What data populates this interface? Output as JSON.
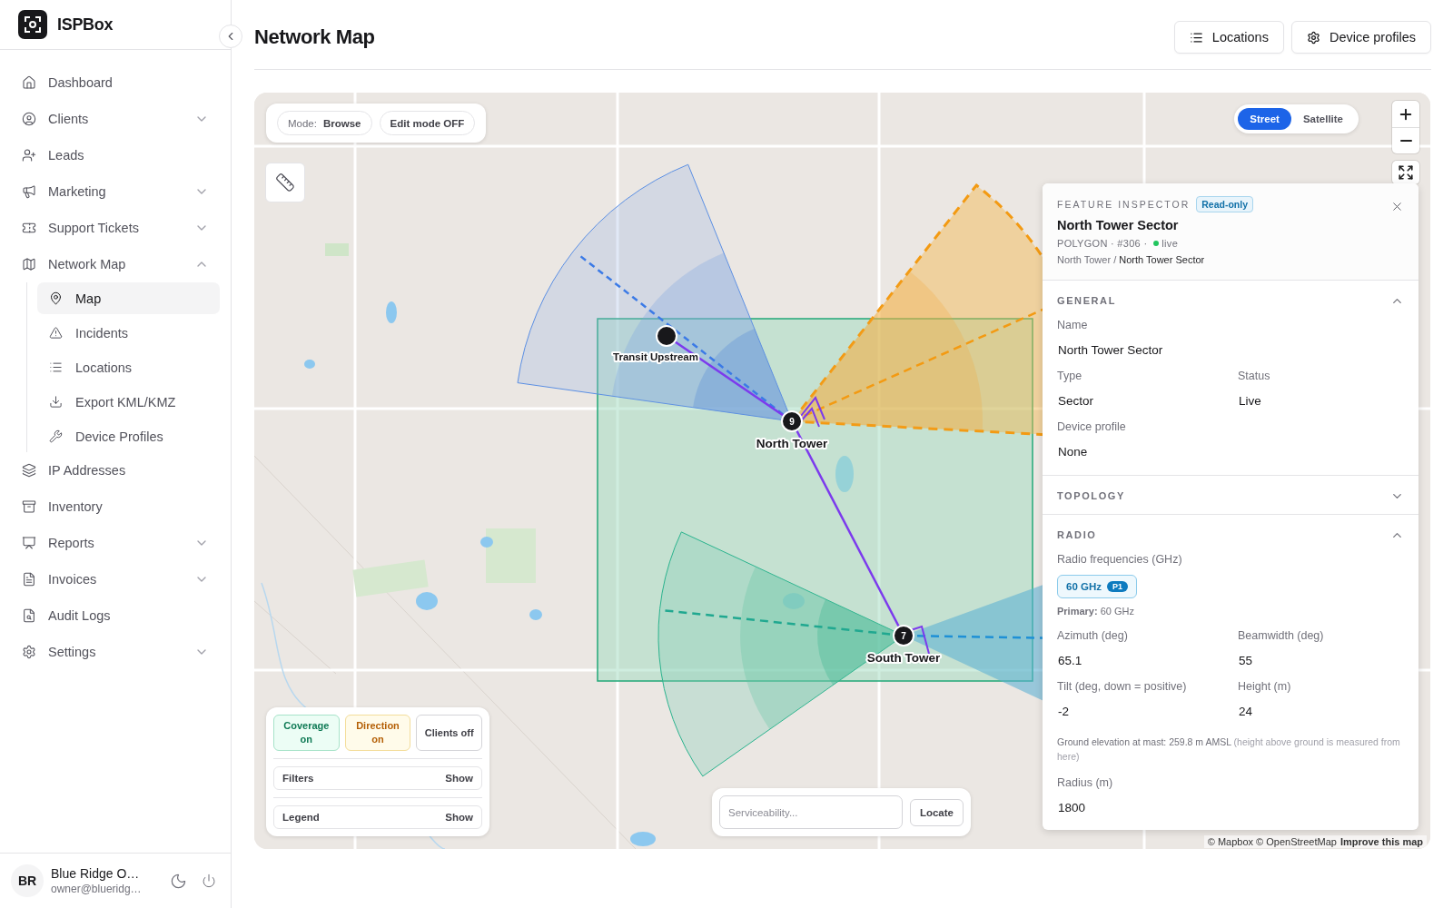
{
  "app": {
    "name": "ISPBox"
  },
  "sidebar": {
    "items": [
      {
        "label": "Dashboard",
        "kind": "link",
        "selected": false
      },
      {
        "label": "Clients",
        "kind": "group",
        "expanded": false,
        "selected": false
      },
      {
        "label": "Leads",
        "kind": "link",
        "selected": false
      },
      {
        "label": "Marketing",
        "kind": "group",
        "expanded": false,
        "selected": false
      },
      {
        "label": "Support Tickets",
        "kind": "group",
        "expanded": false,
        "selected": false
      },
      {
        "label": "Network Map",
        "kind": "group",
        "expanded": true,
        "selected": false,
        "children": [
          {
            "label": "Map",
            "selected": true
          },
          {
            "label": "Incidents",
            "selected": false
          },
          {
            "label": "Locations",
            "selected": false
          },
          {
            "label": "Export KML/KMZ",
            "selected": false
          },
          {
            "label": "Device Profiles",
            "selected": false
          }
        ]
      },
      {
        "label": "IP Addresses",
        "kind": "link",
        "selected": false
      },
      {
        "label": "Inventory",
        "kind": "link",
        "selected": false
      },
      {
        "label": "Reports",
        "kind": "group",
        "expanded": false,
        "selected": false
      },
      {
        "label": "Invoices",
        "kind": "group",
        "expanded": false,
        "selected": false
      },
      {
        "label": "Audit Logs",
        "kind": "link",
        "selected": false
      },
      {
        "label": "Settings",
        "kind": "group",
        "expanded": false,
        "selected": false
      }
    ]
  },
  "user": {
    "initials": "BR",
    "name": "Blue Ridge O…",
    "email": "owner@blueridg…"
  },
  "header": {
    "title": "Network Map",
    "buttons": [
      "Locations",
      "Device profiles"
    ]
  },
  "map": {
    "mode_label": "Mode:",
    "mode_value": "Browse",
    "edit_button": "Edit mode OFF",
    "basemaps": [
      {
        "label": "Street",
        "selected": true
      },
      {
        "label": "Satellite",
        "selected": false
      }
    ],
    "nodes": [
      {
        "label": "Transit Upstream"
      },
      {
        "label": "North Tower",
        "count": "9"
      },
      {
        "label": "South Tower",
        "count": "7"
      }
    ],
    "layer_toggles": [
      {
        "label": "Coverage on",
        "kind": "coverage",
        "on": true
      },
      {
        "label": "Direction on",
        "kind": "direction",
        "on": true
      },
      {
        "label": "Clients off",
        "kind": "clients",
        "on": false
      }
    ],
    "panels": [
      {
        "label": "Filters",
        "action": "Show"
      },
      {
        "label": "Legend",
        "action": "Show"
      }
    ],
    "search": {
      "placeholder": "Serviceability...",
      "button": "Locate"
    },
    "attribution": "© Mapbox © OpenStreetMap",
    "attribution_link": "Improve this map"
  },
  "inspector": {
    "heading": "FEATURE INSPECTOR",
    "badge": "Read-only",
    "title": "North Tower Sector",
    "meta": "POLYGON · #306 ·",
    "status": {
      "label": "live",
      "color": "#22c55e"
    },
    "breadcrumb": "North Tower / **North Tower Sector**",
    "sections": [
      {
        "title": "GENERAL",
        "expanded": true,
        "rows": [
          [
            {
              "label": "Name",
              "value": "North Tower Sector"
            }
          ],
          [
            {
              "label": "Type",
              "value": "Sector"
            },
            {
              "label": "Status",
              "value": "Live"
            }
          ],
          [
            {
              "label": "Device profile",
              "value": "None"
            }
          ]
        ]
      },
      {
        "title": "TOPOLOGY",
        "expanded": false
      },
      {
        "title": "RADIO",
        "expanded": true,
        "frequencies_label": "Radio frequencies (GHz)",
        "chips": [
          {
            "label": "60 GHz",
            "badge": "P1"
          }
        ],
        "primary": "**Primary:** 60 GHz",
        "rows": [
          [
            {
              "label": "Azimuth (deg)",
              "value": "65.1"
            },
            {
              "label": "Beamwidth (deg)",
              "value": "55"
            }
          ],
          [
            {
              "label": "Tilt (deg, down = positive)",
              "value": "-2"
            },
            {
              "label": "Height (m)",
              "value": "24"
            }
          ]
        ],
        "note": "Ground elevation at mast: 259.8 m AMSL",
        "note_aside": "(height above ground is measured from here)",
        "after_rows": [
          [
            {
              "label": "Radius (m)",
              "value": "1800"
            }
          ]
        ]
      }
    ]
  }
}
